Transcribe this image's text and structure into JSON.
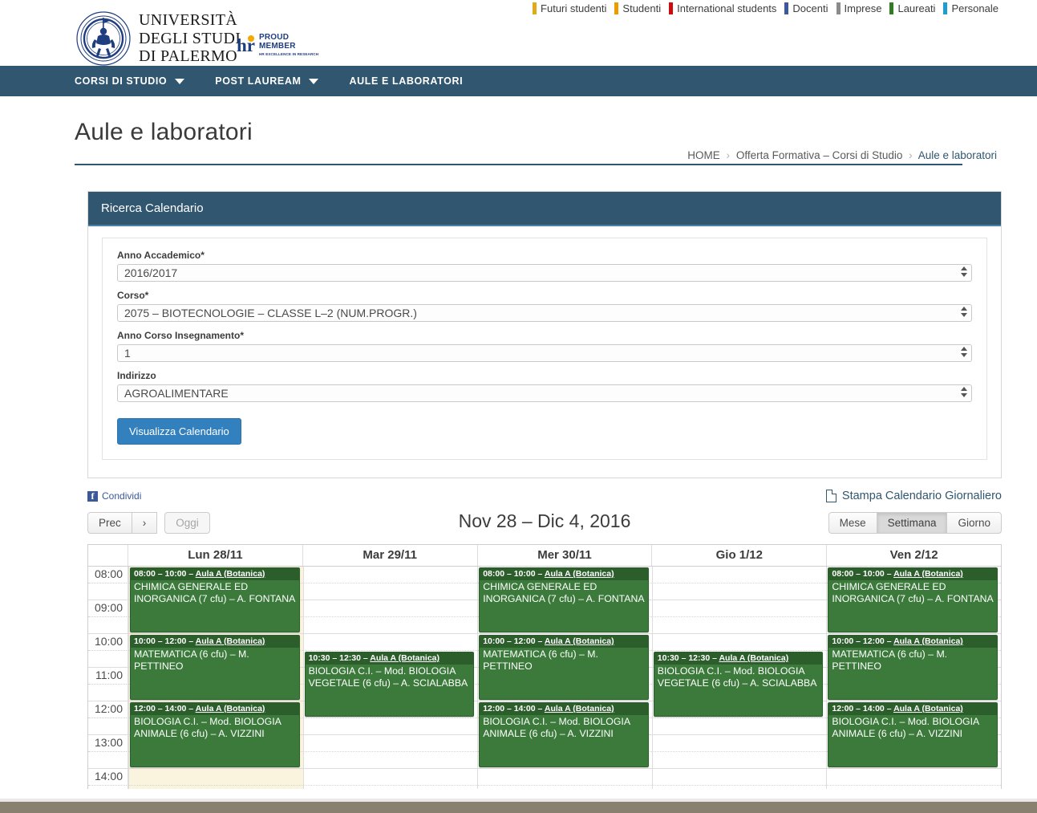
{
  "audience_bar": [
    {
      "label": "Futuri studenti",
      "color": "#e0ab1b"
    },
    {
      "label": "Studenti",
      "color": "#ef9b00"
    },
    {
      "label": "International students",
      "color": "#cf0a0a"
    },
    {
      "label": "Docenti",
      "color": "#3a5a9b"
    },
    {
      "label": "Imprese",
      "color": "#8b8b8b"
    },
    {
      "label": "Laureati",
      "color": "#2f7d1f"
    },
    {
      "label": "Personale",
      "color": "#1b9ed0"
    }
  ],
  "brand": {
    "university_line1": "UNIVERSITÀ",
    "university_line2": "DEGLI STUDI",
    "university_line3": "DI PALERMO",
    "crest_motto": "PANORMITANAE STUDIORUM UNIVERSITATIS SIGILLUM",
    "hr_mark": "hr",
    "hr_line1": "PROUD",
    "hr_line2": "MEMBER",
    "hr_line3": "HR EXCELLENCE IN RESEARCH"
  },
  "nav": [
    {
      "label": "CORSI DI STUDIO",
      "has_caret": true
    },
    {
      "label": "POST LAUREAM",
      "has_caret": true
    },
    {
      "label": "AULE E LABORATORI",
      "has_caret": false
    }
  ],
  "page": {
    "title": "Aule e laboratori"
  },
  "breadcrumb": {
    "home": "HOME",
    "parent": "Offerta Formativa – Corsi di Studio",
    "current": "Aule e laboratori",
    "separator": "›"
  },
  "search_panel": {
    "heading": "Ricerca Calendario",
    "fields": [
      {
        "label": "Anno Accademico*",
        "value": "2016/2017"
      },
      {
        "label": "Corso*",
        "value": "2075 – BIOTECNOLOGIE – CLASSE L–2 (NUM.PROGR.)"
      },
      {
        "label": "Anno Corso Insegnamento*",
        "value": "1"
      },
      {
        "label": "Indirizzo",
        "value": "AGROALIMENTARE"
      }
    ],
    "submit_label": "Visualizza Calendario"
  },
  "share": {
    "facebook_label": "Condividi",
    "facebook_glyph": "f",
    "print_label": "Stampa Calendario Giornaliero"
  },
  "calendar_toolbar": {
    "prev_label": "Prec",
    "next_label": "›",
    "today_label": "Oggi",
    "title": "Nov 28 – Dic 4, 2016",
    "views": [
      {
        "label": "Mese",
        "active": false
      },
      {
        "label": "Settimana",
        "active": true
      },
      {
        "label": "Giorno",
        "active": false
      }
    ]
  },
  "calendar": {
    "day_headers": [
      "Lun 28/11",
      "Mar 29/11",
      "Mer 30/11",
      "Gio 1/12",
      "Ven 2/12"
    ],
    "today_index": 0,
    "time_slots": [
      "08:00",
      "09:00",
      "10:00",
      "11:00",
      "12:00",
      "13:00",
      "14:00"
    ],
    "events": [
      {
        "day": 0,
        "start": "08:00",
        "end": "10:00",
        "room": "Aula A (Botanica)",
        "title": "CHIMICA GENERALE ED INORGANICA (7 cfu) – A. FONTANA"
      },
      {
        "day": 0,
        "start": "10:00",
        "end": "12:00",
        "room": "Aula A (Botanica)",
        "title": "MATEMATICA (6 cfu) – M. PETTINEO"
      },
      {
        "day": 0,
        "start": "12:00",
        "end": "14:00",
        "room": "Aula A (Botanica)",
        "title": "BIOLOGIA C.I. – Mod. BIOLOGIA ANIMALE (6 cfu) – A. VIZZINI"
      },
      {
        "day": 1,
        "start": "10:30",
        "end": "12:30",
        "room": "Aula A (Botanica)",
        "title": "BIOLOGIA C.I. – Mod. BIOLOGIA VEGETALE (6 cfu) – A. SCIALABBA"
      },
      {
        "day": 2,
        "start": "08:00",
        "end": "10:00",
        "room": "Aula A (Botanica)",
        "title": "CHIMICA GENERALE ED INORGANICA (7 cfu) – A. FONTANA"
      },
      {
        "day": 2,
        "start": "10:00",
        "end": "12:00",
        "room": "Aula A (Botanica)",
        "title": "MATEMATICA (6 cfu) – M. PETTINEO"
      },
      {
        "day": 2,
        "start": "12:00",
        "end": "14:00",
        "room": "Aula A (Botanica)",
        "title": "BIOLOGIA C.I. – Mod. BIOLOGIA ANIMALE (6 cfu) – A. VIZZINI"
      },
      {
        "day": 3,
        "start": "10:30",
        "end": "12:30",
        "room": "Aula A (Botanica)",
        "title": "BIOLOGIA C.I. – Mod. BIOLOGIA VEGETALE (6 cfu) – A. SCIALABBA"
      },
      {
        "day": 4,
        "start": "08:00",
        "end": "10:00",
        "room": "Aula A (Botanica)",
        "title": "CHIMICA GENERALE ED INORGANICA (7 cfu) – A. FONTANA"
      },
      {
        "day": 4,
        "start": "10:00",
        "end": "12:00",
        "room": "Aula A (Botanica)",
        "title": "MATEMATICA (6 cfu) – M. PETTINEO"
      },
      {
        "day": 4,
        "start": "12:00",
        "end": "14:00",
        "room": "Aula A (Botanica)",
        "title": "BIOLOGIA C.I. – Mod. BIOLOGIA ANIMALE (6 cfu) – A. VIZZINI"
      }
    ],
    "event_color": "#3b7a3b",
    "event_header_color": "#2c5e2c",
    "today_color": "#faf3dd"
  }
}
